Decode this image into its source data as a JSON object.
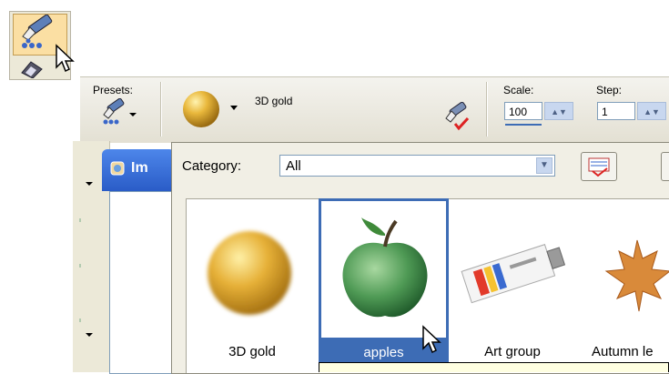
{
  "toolbar": {
    "presets_label": "Presets:",
    "material_name": "3D gold",
    "scale_label": "Scale:",
    "scale_value": "100",
    "step_label": "Step:",
    "step_value": "1"
  },
  "document": {
    "tab_title": "Im"
  },
  "picker": {
    "category_label": "Category:",
    "category_value": "All",
    "items": [
      {
        "label": "3D gold"
      },
      {
        "label": "apples",
        "selected": true
      },
      {
        "label": "Art group"
      },
      {
        "label": "Autumn le"
      }
    ]
  },
  "colors": {
    "selection_blue": "#3d6cb5",
    "toolbar_bg": "#ece9d8",
    "tool_highlight": "#fbdfa3"
  }
}
